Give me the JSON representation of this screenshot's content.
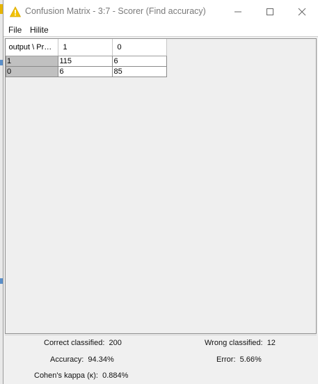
{
  "window": {
    "title": "Confusion Matrix - 3:7 - Scorer (Find accuracy)",
    "icon": "warning-triangle-icon",
    "controls": [
      "minimize-icon",
      "maximize-icon",
      "close-icon"
    ]
  },
  "menu": {
    "file": "File",
    "hilite": "Hilite"
  },
  "matrix": {
    "corner": "output \\ Pr…",
    "columns": [
      "1",
      "0"
    ],
    "rows": [
      {
        "label": "1",
        "values": [
          "115",
          "6"
        ]
      },
      {
        "label": "0",
        "values": [
          "6",
          "85"
        ]
      }
    ]
  },
  "stats": {
    "correct_label": "Correct classified:",
    "correct_value": "200",
    "wrong_label": "Wrong classified:",
    "wrong_value": "12",
    "accuracy_label": "Accuracy:",
    "accuracy_value": "94.34%",
    "error_label": "Error:",
    "error_value": "5.66%",
    "kappa_label": "Cohen's kappa (κ):",
    "kappa_value": "0.884%"
  },
  "colors": {
    "title_text": "#7a7a7a",
    "row_header": "#c0c0c0",
    "icon_yellow": "#f2c200"
  }
}
